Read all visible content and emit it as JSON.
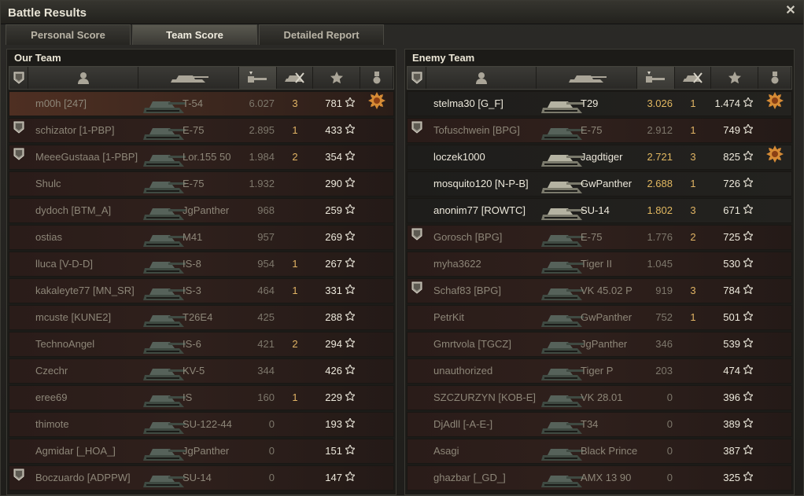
{
  "window": {
    "title": "Battle Results"
  },
  "tabs": [
    {
      "label": "Personal Score",
      "active": false
    },
    {
      "label": "Team Score",
      "active": true
    },
    {
      "label": "Detailed Report",
      "active": false
    }
  ],
  "our_team": {
    "label": "Our Team",
    "players": [
      {
        "name": "m00h [247]",
        "tank": "T-54",
        "damage": "6.027",
        "frags": "3",
        "xp": "781",
        "platoon": false,
        "alive": false,
        "self": true,
        "medal": "2"
      },
      {
        "name": "schizator [1-PBP]",
        "tank": "E-75",
        "damage": "2.895",
        "frags": "1",
        "xp": "433",
        "platoon": true,
        "alive": false
      },
      {
        "name": "MeeeGustaaa [1-PBP]",
        "tank": "Lor.155 50",
        "damage": "1.984",
        "frags": "2",
        "xp": "354",
        "platoon": true,
        "alive": false
      },
      {
        "name": "Shulc",
        "tank": "E-75",
        "damage": "1.932",
        "frags": "",
        "xp": "290",
        "platoon": false,
        "alive": false
      },
      {
        "name": "dydoch [BTM_A]",
        "tank": "JgPanther",
        "damage": "968",
        "frags": "",
        "xp": "259",
        "platoon": false,
        "alive": false
      },
      {
        "name": "ostias",
        "tank": "M41",
        "damage": "957",
        "frags": "",
        "xp": "269",
        "platoon": false,
        "alive": false
      },
      {
        "name": "lluca [V-D-D]",
        "tank": "IS-8",
        "damage": "954",
        "frags": "1",
        "xp": "267",
        "platoon": false,
        "alive": false
      },
      {
        "name": "kakaleyte77 [MN_SR]",
        "tank": "IS-3",
        "damage": "464",
        "frags": "1",
        "xp": "331",
        "platoon": false,
        "alive": false
      },
      {
        "name": "mcuste [KUNE2]",
        "tank": "T26E4",
        "damage": "425",
        "frags": "",
        "xp": "288",
        "platoon": false,
        "alive": false
      },
      {
        "name": "TechnoAngel",
        "tank": "IS-6",
        "damage": "421",
        "frags": "2",
        "xp": "294",
        "platoon": false,
        "alive": false
      },
      {
        "name": "Czechr",
        "tank": "KV-5",
        "damage": "344",
        "frags": "",
        "xp": "426",
        "platoon": false,
        "alive": false
      },
      {
        "name": "eree69",
        "tank": "IS",
        "damage": "160",
        "frags": "1",
        "xp": "229",
        "platoon": false,
        "alive": false
      },
      {
        "name": "thimote",
        "tank": "SU-122-44",
        "damage": "0",
        "frags": "",
        "xp": "193",
        "platoon": false,
        "alive": false
      },
      {
        "name": "Agmidar [_HOA_]",
        "tank": "JgPanther",
        "damage": "0",
        "frags": "",
        "xp": "151",
        "platoon": false,
        "alive": false
      },
      {
        "name": "Boczuardo [ADPPW]",
        "tank": "SU-14",
        "damage": "0",
        "frags": "",
        "xp": "147",
        "platoon": true,
        "alive": false
      }
    ]
  },
  "enemy_team": {
    "label": "Enemy Team",
    "players": [
      {
        "name": "stelma30 [G_F]",
        "tank": "T29",
        "damage": "3.026",
        "frags": "1",
        "xp": "1.474",
        "platoon": false,
        "alive": true,
        "medal": "2"
      },
      {
        "name": "Tofuschwein [BPG]",
        "tank": "E-75",
        "damage": "2.912",
        "frags": "1",
        "xp": "749",
        "platoon": true,
        "alive": false
      },
      {
        "name": "loczek1000",
        "tank": "Jagdtiger",
        "damage": "2.721",
        "frags": "3",
        "xp": "825",
        "platoon": false,
        "alive": true,
        "medal": "1"
      },
      {
        "name": "mosquito120 [N-P-B]",
        "tank": "GwPanther",
        "damage": "2.688",
        "frags": "1",
        "xp": "726",
        "platoon": false,
        "alive": true
      },
      {
        "name": "anonim77 [ROWTC]",
        "tank": "SU-14",
        "damage": "1.802",
        "frags": "3",
        "xp": "671",
        "platoon": false,
        "alive": true
      },
      {
        "name": "Gorosch [BPG]",
        "tank": "E-75",
        "damage": "1.776",
        "frags": "2",
        "xp": "725",
        "platoon": true,
        "alive": false
      },
      {
        "name": "myha3622",
        "tank": "Tiger II",
        "damage": "1.045",
        "frags": "",
        "xp": "530",
        "platoon": false,
        "alive": false
      },
      {
        "name": "Schaf83 [BPG]",
        "tank": "VK 45.02 P",
        "damage": "919",
        "frags": "3",
        "xp": "784",
        "platoon": true,
        "alive": false
      },
      {
        "name": "PetrKit",
        "tank": "GwPanther",
        "damage": "752",
        "frags": "1",
        "xp": "501",
        "platoon": false,
        "alive": false
      },
      {
        "name": "Gmrtvola [TGCZ]",
        "tank": "JgPanther",
        "damage": "346",
        "frags": "",
        "xp": "539",
        "platoon": false,
        "alive": false
      },
      {
        "name": "unauthorized",
        "tank": "Tiger P",
        "damage": "203",
        "frags": "",
        "xp": "474",
        "platoon": false,
        "alive": false
      },
      {
        "name": "SZCZURZYN [KOB-E]",
        "tank": "VK 28.01",
        "damage": "0",
        "frags": "",
        "xp": "396",
        "platoon": false,
        "alive": false
      },
      {
        "name": "DjAdll [-A-E-]",
        "tank": "T34",
        "damage": "0",
        "frags": "",
        "xp": "389",
        "platoon": false,
        "alive": false
      },
      {
        "name": "Asagi",
        "tank": "Black Prince",
        "damage": "0",
        "frags": "",
        "xp": "387",
        "platoon": false,
        "alive": false
      },
      {
        "name": "ghazbar [_GD_]",
        "tank": "AMX 13 90",
        "damage": "0",
        "frags": "",
        "xp": "325",
        "platoon": false,
        "alive": false
      }
    ]
  },
  "icons": {
    "platoon": "squad-icon",
    "player": "person-icon",
    "tank": "tank-icon",
    "damage": "gun-damage-icon",
    "frags": "destroyed-tank-icon",
    "xp": "star-icon",
    "medals": "medal-icon",
    "close": "close-icon"
  },
  "colors": {
    "damage_alive": "#e2b861",
    "dead_row": "#2f201c",
    "dead_text": "#8d8678",
    "alive_text": "#ece8db"
  }
}
